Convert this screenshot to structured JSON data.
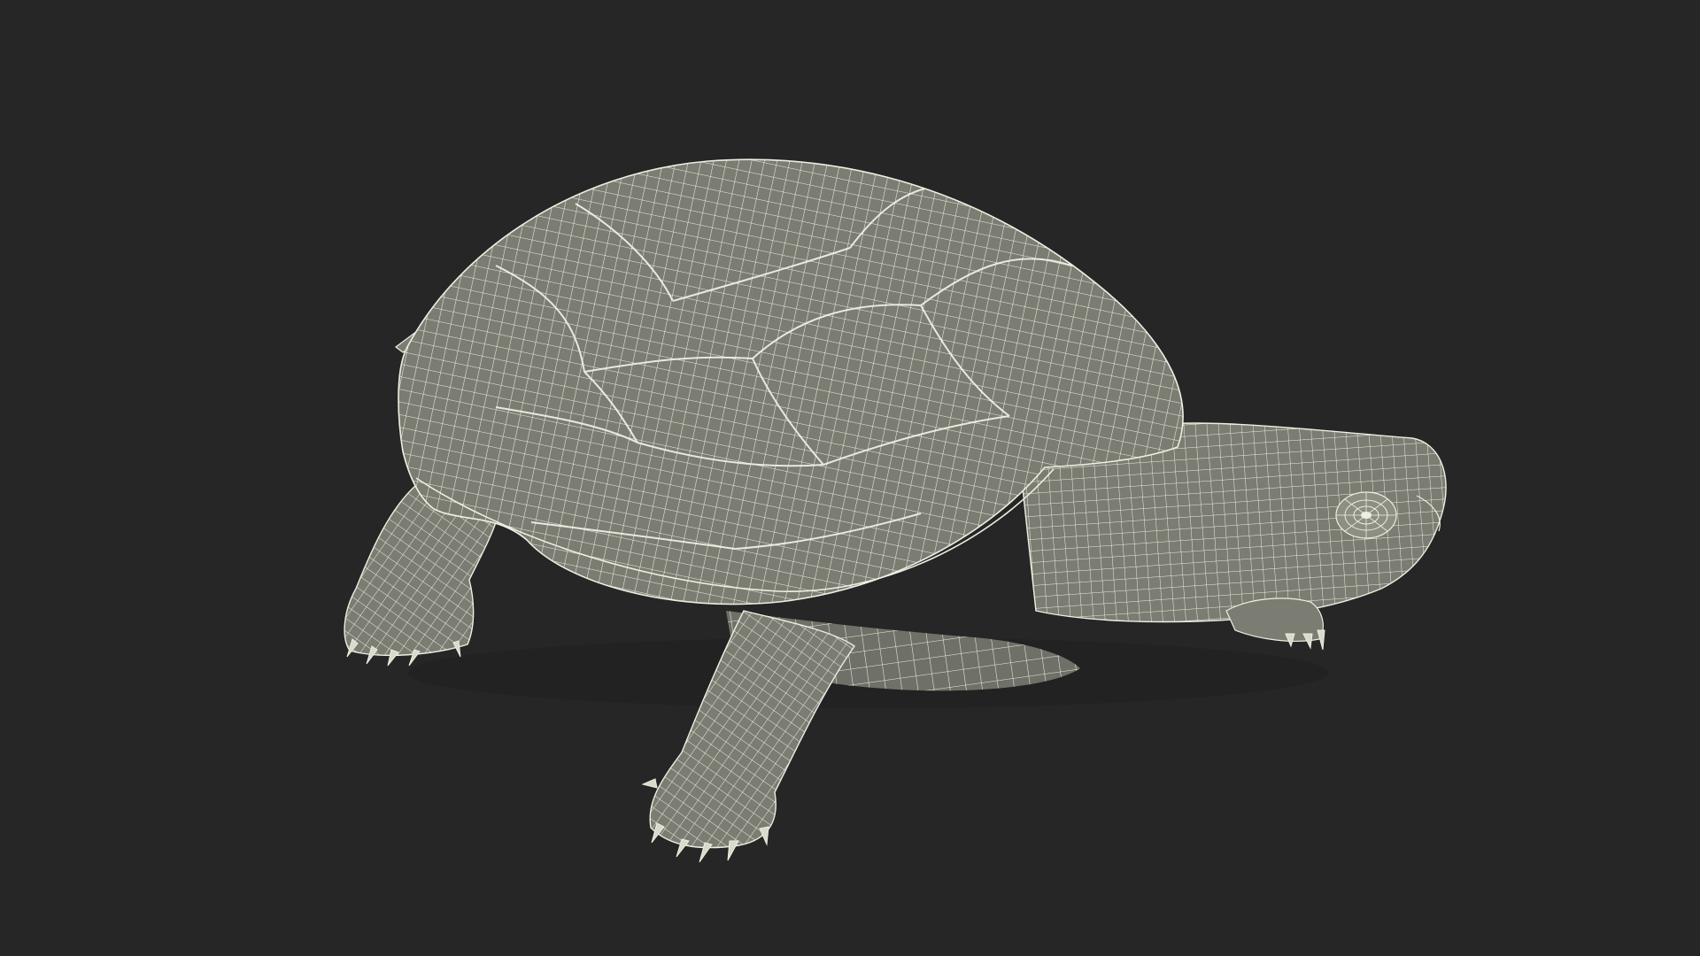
{
  "scene": {
    "subject": "turtle",
    "render_mode": "wireframe",
    "colors": {
      "background": "#262626",
      "surface": "#7b7c72",
      "surface_light": "#8d8e84",
      "surface_dark": "#66675e",
      "wire": "#eeeee2",
      "shadow": "#1c1c1c"
    }
  }
}
